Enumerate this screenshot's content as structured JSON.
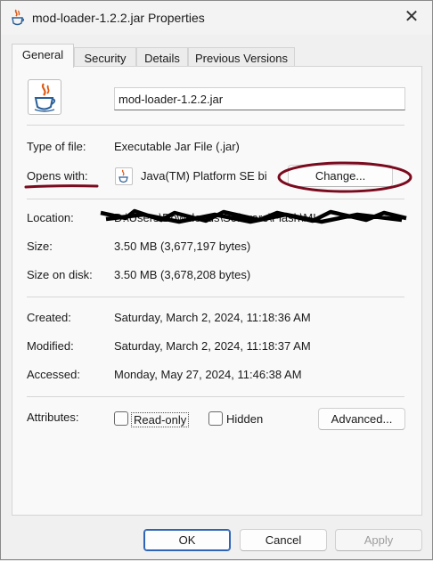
{
  "window": {
    "title": "mod-loader-1.2.2.jar Properties",
    "close_glyph": "✕"
  },
  "tabs": [
    {
      "label": "General",
      "active": true
    },
    {
      "label": "Security",
      "active": false
    },
    {
      "label": "Details",
      "active": false
    },
    {
      "label": "Previous Versions",
      "active": false
    }
  ],
  "general": {
    "file_name": "mod-loader-1.2.2.jar",
    "file_icon": "java-icon",
    "type_label": "Type of file:",
    "type_value": "Executable Jar File (.jar)",
    "opens_label": "Opens with:",
    "opens_value": "Java(TM) Platform SE bi",
    "change_button": "Change...",
    "location_label": "Location:",
    "location_value": "D:\\Users\\Downloads\\Software\\Flash\\ML",
    "size_label": "Size:",
    "size_value": "3.50 MB (3,677,197 bytes)",
    "size_on_disk_label": "Size on disk:",
    "size_on_disk_value": "3.50 MB (3,678,208 bytes)",
    "created_label": "Created:",
    "created_value": "Saturday, March 2, 2024, 11:18:36 AM",
    "modified_label": "Modified:",
    "modified_value": "Saturday, March 2, 2024, 11:18:37 AM",
    "accessed_label": "Accessed:",
    "accessed_value": "Monday, May 27, 2024, 11:46:38 AM",
    "attributes_label": "Attributes:",
    "readonly_label": "Read-only",
    "readonly_checked": false,
    "hidden_label": "Hidden",
    "hidden_checked": false,
    "advanced_button": "Advanced..."
  },
  "footer": {
    "ok": "OK",
    "cancel": "Cancel",
    "apply": "Apply"
  },
  "colors": {
    "annotation": "#7a0a1e",
    "primary_border": "#2d64b8",
    "disabled_text": "#9d9d9d"
  }
}
